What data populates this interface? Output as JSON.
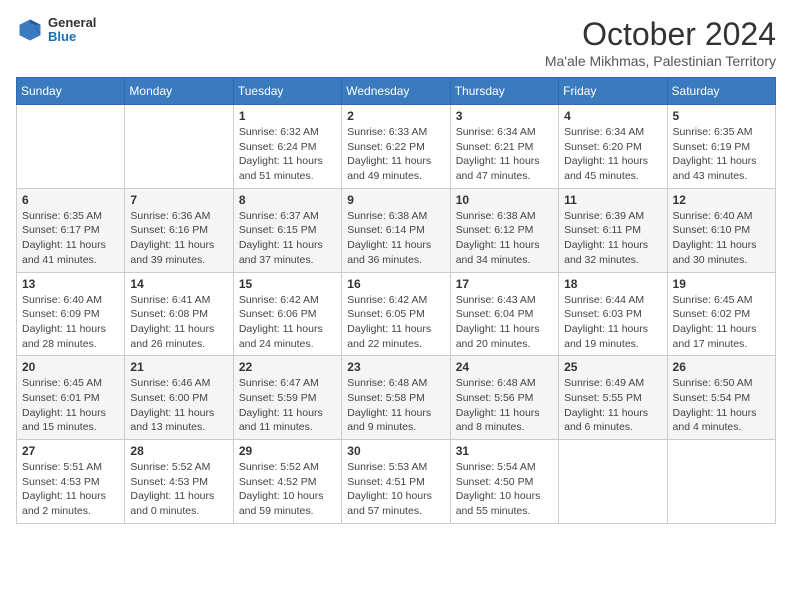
{
  "header": {
    "logo": {
      "general": "General",
      "blue": "Blue"
    },
    "title": "October 2024",
    "location": "Ma'ale Mikhmas, Palestinian Territory"
  },
  "days_of_week": [
    "Sunday",
    "Monday",
    "Tuesday",
    "Wednesday",
    "Thursday",
    "Friday",
    "Saturday"
  ],
  "weeks": [
    [
      {
        "day": "",
        "info": ""
      },
      {
        "day": "",
        "info": ""
      },
      {
        "day": "1",
        "info": "Sunrise: 6:32 AM\nSunset: 6:24 PM\nDaylight: 11 hours and 51 minutes."
      },
      {
        "day": "2",
        "info": "Sunrise: 6:33 AM\nSunset: 6:22 PM\nDaylight: 11 hours and 49 minutes."
      },
      {
        "day": "3",
        "info": "Sunrise: 6:34 AM\nSunset: 6:21 PM\nDaylight: 11 hours and 47 minutes."
      },
      {
        "day": "4",
        "info": "Sunrise: 6:34 AM\nSunset: 6:20 PM\nDaylight: 11 hours and 45 minutes."
      },
      {
        "day": "5",
        "info": "Sunrise: 6:35 AM\nSunset: 6:19 PM\nDaylight: 11 hours and 43 minutes."
      }
    ],
    [
      {
        "day": "6",
        "info": "Sunrise: 6:35 AM\nSunset: 6:17 PM\nDaylight: 11 hours and 41 minutes."
      },
      {
        "day": "7",
        "info": "Sunrise: 6:36 AM\nSunset: 6:16 PM\nDaylight: 11 hours and 39 minutes."
      },
      {
        "day": "8",
        "info": "Sunrise: 6:37 AM\nSunset: 6:15 PM\nDaylight: 11 hours and 37 minutes."
      },
      {
        "day": "9",
        "info": "Sunrise: 6:38 AM\nSunset: 6:14 PM\nDaylight: 11 hours and 36 minutes."
      },
      {
        "day": "10",
        "info": "Sunrise: 6:38 AM\nSunset: 6:12 PM\nDaylight: 11 hours and 34 minutes."
      },
      {
        "day": "11",
        "info": "Sunrise: 6:39 AM\nSunset: 6:11 PM\nDaylight: 11 hours and 32 minutes."
      },
      {
        "day": "12",
        "info": "Sunrise: 6:40 AM\nSunset: 6:10 PM\nDaylight: 11 hours and 30 minutes."
      }
    ],
    [
      {
        "day": "13",
        "info": "Sunrise: 6:40 AM\nSunset: 6:09 PM\nDaylight: 11 hours and 28 minutes."
      },
      {
        "day": "14",
        "info": "Sunrise: 6:41 AM\nSunset: 6:08 PM\nDaylight: 11 hours and 26 minutes."
      },
      {
        "day": "15",
        "info": "Sunrise: 6:42 AM\nSunset: 6:06 PM\nDaylight: 11 hours and 24 minutes."
      },
      {
        "day": "16",
        "info": "Sunrise: 6:42 AM\nSunset: 6:05 PM\nDaylight: 11 hours and 22 minutes."
      },
      {
        "day": "17",
        "info": "Sunrise: 6:43 AM\nSunset: 6:04 PM\nDaylight: 11 hours and 20 minutes."
      },
      {
        "day": "18",
        "info": "Sunrise: 6:44 AM\nSunset: 6:03 PM\nDaylight: 11 hours and 19 minutes."
      },
      {
        "day": "19",
        "info": "Sunrise: 6:45 AM\nSunset: 6:02 PM\nDaylight: 11 hours and 17 minutes."
      }
    ],
    [
      {
        "day": "20",
        "info": "Sunrise: 6:45 AM\nSunset: 6:01 PM\nDaylight: 11 hours and 15 minutes."
      },
      {
        "day": "21",
        "info": "Sunrise: 6:46 AM\nSunset: 6:00 PM\nDaylight: 11 hours and 13 minutes."
      },
      {
        "day": "22",
        "info": "Sunrise: 6:47 AM\nSunset: 5:59 PM\nDaylight: 11 hours and 11 minutes."
      },
      {
        "day": "23",
        "info": "Sunrise: 6:48 AM\nSunset: 5:58 PM\nDaylight: 11 hours and 9 minutes."
      },
      {
        "day": "24",
        "info": "Sunrise: 6:48 AM\nSunset: 5:56 PM\nDaylight: 11 hours and 8 minutes."
      },
      {
        "day": "25",
        "info": "Sunrise: 6:49 AM\nSunset: 5:55 PM\nDaylight: 11 hours and 6 minutes."
      },
      {
        "day": "26",
        "info": "Sunrise: 6:50 AM\nSunset: 5:54 PM\nDaylight: 11 hours and 4 minutes."
      }
    ],
    [
      {
        "day": "27",
        "info": "Sunrise: 5:51 AM\nSunset: 4:53 PM\nDaylight: 11 hours and 2 minutes."
      },
      {
        "day": "28",
        "info": "Sunrise: 5:52 AM\nSunset: 4:53 PM\nDaylight: 11 hours and 0 minutes."
      },
      {
        "day": "29",
        "info": "Sunrise: 5:52 AM\nSunset: 4:52 PM\nDaylight: 10 hours and 59 minutes."
      },
      {
        "day": "30",
        "info": "Sunrise: 5:53 AM\nSunset: 4:51 PM\nDaylight: 10 hours and 57 minutes."
      },
      {
        "day": "31",
        "info": "Sunrise: 5:54 AM\nSunset: 4:50 PM\nDaylight: 10 hours and 55 minutes."
      },
      {
        "day": "",
        "info": ""
      },
      {
        "day": "",
        "info": ""
      }
    ]
  ]
}
